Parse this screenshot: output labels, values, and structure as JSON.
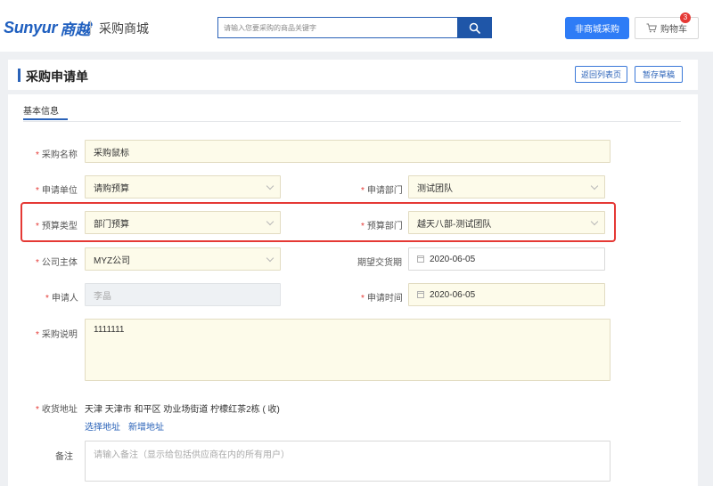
{
  "header": {
    "logo_en": "Sunyur",
    "logo_cn": "商越",
    "mall_title": "采购商城",
    "search_placeholder": "请输入您要采购的商品关键字",
    "nonmall_button": "非商城采购",
    "cart_label": "购物车",
    "cart_count": "3"
  },
  "page": {
    "title": "采购申请单",
    "back_button": "返回列表页",
    "draft_button": "暂存草稿",
    "tab_basic": "基本信息"
  },
  "form": {
    "purchase_name": {
      "label": "采购名称",
      "value": "采购鼠标"
    },
    "apply_unit": {
      "label": "申请单位",
      "value": "请购预算"
    },
    "apply_dept": {
      "label": "申请部门",
      "value": "测试团队"
    },
    "budget_type": {
      "label": "预算类型",
      "value": "部门预算"
    },
    "budget_dept": {
      "label": "预算部门",
      "value": "越天八部-测试团队"
    },
    "company": {
      "label": "公司主体",
      "value": "MYZ公司"
    },
    "expected_date": {
      "label": "期望交货期",
      "value": "2020-06-05"
    },
    "applicant": {
      "label": "申请人",
      "value": "李晶"
    },
    "apply_time": {
      "label": "申请时间",
      "value": "2020-06-05"
    },
    "description": {
      "label": "采购说明",
      "value": "1111111"
    },
    "address": {
      "label": "收货地址",
      "value": "天津 天津市 和平区 劝业场街道 柠檬红茶2栋 ( 收)",
      "select_link": "选择地址",
      "add_link": "新增地址"
    },
    "remark": {
      "label": "备注",
      "placeholder": "请输入备注（显示给包括供应商在内的所有用户）"
    }
  },
  "colors": {
    "accent": "#2a62b8",
    "primary_button": "#2e7cf6",
    "required_mark": "#e53935",
    "highlight_box": "#e53935",
    "field_bg": "#fdfbea"
  }
}
